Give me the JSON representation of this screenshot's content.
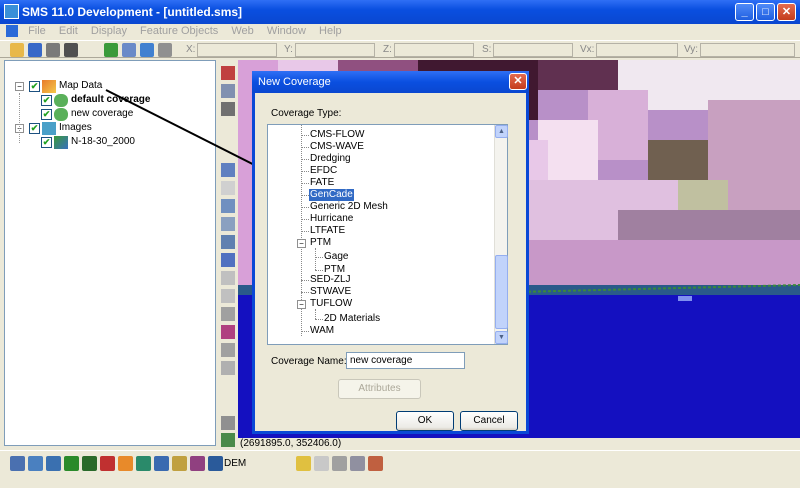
{
  "window": {
    "title": "SMS 11.0 Development - [untitled.sms]",
    "minimize": "_",
    "maximize": "□",
    "close": "✕"
  },
  "menu": [
    "File",
    "Edit",
    "Display",
    "Feature Objects",
    "Web",
    "Window",
    "Help"
  ],
  "coords": {
    "x": "X:",
    "y": "Y:",
    "z": "Z:",
    "s": "S:",
    "vx": "Vx:",
    "vy": "Vy:"
  },
  "tree": {
    "map_data": "Map Data",
    "default_coverage": "default coverage",
    "new_coverage": "new coverage",
    "images": "Images",
    "image_file": "N-18-30_2000",
    "check": "✔",
    "minus": "−"
  },
  "status": {
    "coordinates": "(2691895.0, 352406.0)"
  },
  "bottom": {
    "dem": "DEM"
  },
  "dialog": {
    "title": "New Coverage",
    "close": "✕",
    "type_label": "Coverage Type:",
    "list": [
      "CMS-FLOW",
      "CMS-WAVE",
      "Dredging",
      "EFDC",
      "FATE",
      "GenCade",
      "Generic 2D Mesh",
      "Hurricane",
      "LTFATE",
      "PTM",
      "Gage",
      "PTM",
      "SED-ZLJ",
      "STWAVE",
      "TUFLOW",
      "2D Materials",
      "WAM"
    ],
    "selected": "GenCade",
    "name_label": "Coverage Name:",
    "name_value": "new coverage",
    "attributes": "Attributes",
    "ok": "OK",
    "cancel": "Cancel",
    "scroll_up": "▲",
    "scroll_down": "▼"
  }
}
